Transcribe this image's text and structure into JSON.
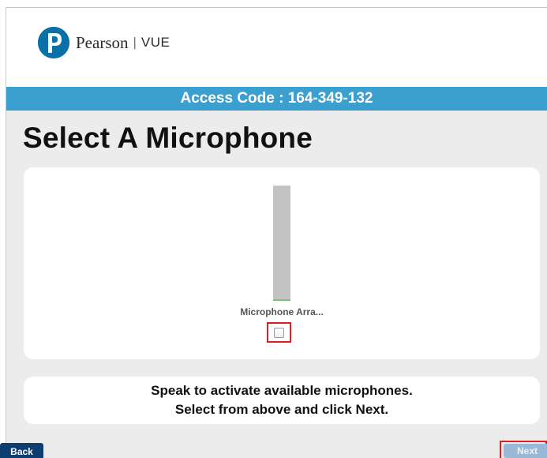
{
  "header": {
    "logo_name": "Pearson",
    "logo_separator": "|",
    "logo_product": "VUE",
    "logo_icon": "pearson-p-logo-icon"
  },
  "access_bar": {
    "text": "Access Code : 164-349-132"
  },
  "main": {
    "title": "Select A Microphone",
    "microphone": {
      "name": "Microphone Arra...",
      "level": 0.01,
      "selected": false
    },
    "instructions": {
      "line1": "Speak to activate available microphones.",
      "line2": "Select from above and click Next."
    }
  },
  "footer": {
    "back_label": "Back",
    "next_label": "Next",
    "next_enabled": false
  },
  "colors": {
    "accent_bar": "#3b9fd0",
    "back_button": "#0e3d72",
    "next_button_disabled": "#9ab9d7",
    "highlight": "#d81f26",
    "content_bg": "#ececec"
  }
}
